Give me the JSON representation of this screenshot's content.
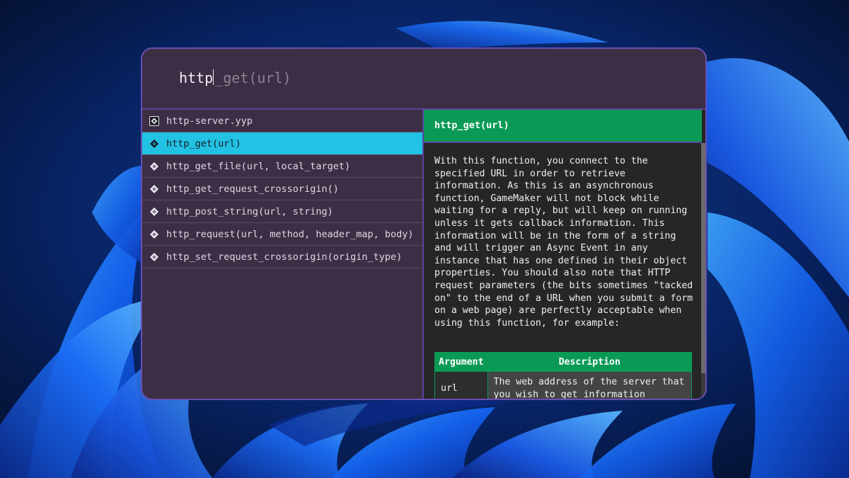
{
  "search": {
    "typed": "http",
    "suggestion": "_get(url)"
  },
  "results": [
    {
      "label": "http-server.yyp",
      "icon": "project-file-icon"
    },
    {
      "label": "http_get(url)",
      "icon": "function-icon",
      "selected": true
    },
    {
      "label": "http_get_file(url, local_target)",
      "icon": "function-icon"
    },
    {
      "label": "http_get_request_crossorigin()",
      "icon": "function-icon"
    },
    {
      "label": "http_post_string(url, string)",
      "icon": "function-icon"
    },
    {
      "label": "http_request(url, method, header_map, body)",
      "icon": "function-icon"
    },
    {
      "label": "http_set_request_crossorigin(origin_type)",
      "icon": "function-icon"
    }
  ],
  "detail": {
    "title": "http_get(url)",
    "description": "With this function, you connect to the specified URL in order to retrieve information. As this is an asynchronous function, GameMaker will not block while waiting for a reply, but will keep on running unless it gets callback information. This information will be in the form of a string and will trigger an Async Event in any instance that has one defined in their object properties. You should also note that HTTP request parameters (the bits sometimes \"tacked on\" to the end of a URL when you submit a form on a web page) are perfectly acceptable when using this function, for example:",
    "table": {
      "headers": [
        "Argument",
        "Description"
      ],
      "rows": [
        {
          "argument": "url",
          "description": "The web address of the server that you wish to get information"
        }
      ]
    }
  },
  "colors": {
    "window_bg": "#3c2f45",
    "window_border": "#6a4fb3",
    "selected_row": "#22c2e4",
    "accent_green": "#0b9a56",
    "detail_bg": "#262626"
  }
}
